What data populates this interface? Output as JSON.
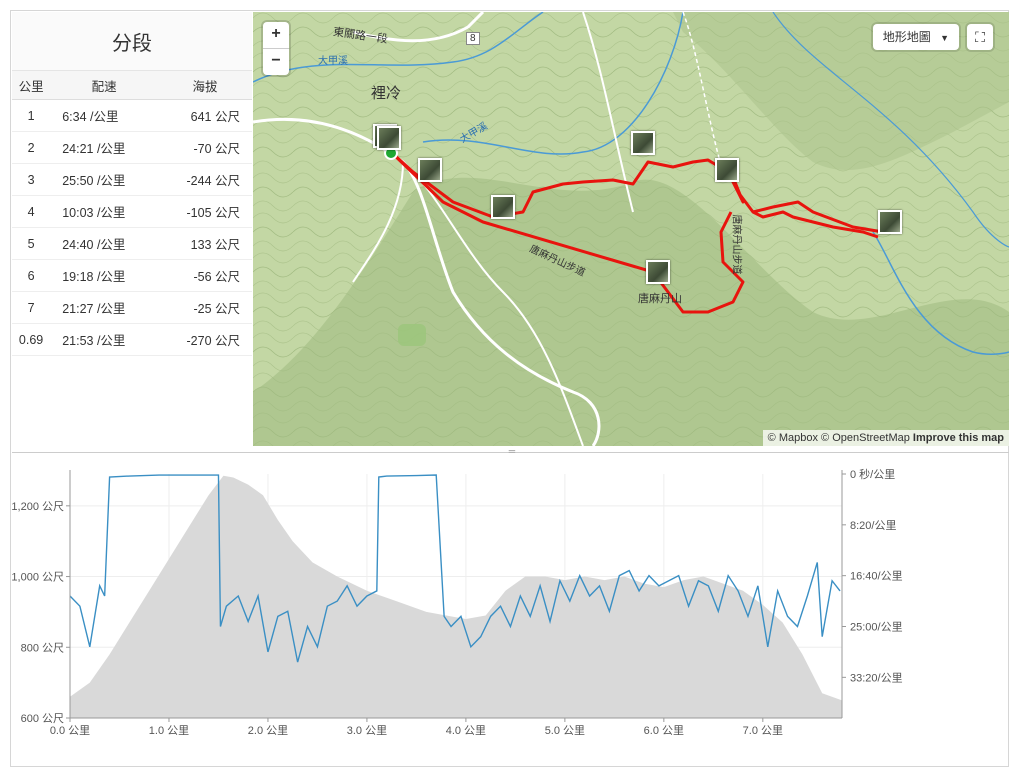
{
  "splits": {
    "title": "分段",
    "headers": [
      "公里",
      "配速",
      "海拔"
    ],
    "rows": [
      {
        "km": "1",
        "pace": "6:34 /公里",
        "elev": "641 公尺"
      },
      {
        "km": "2",
        "pace": "24:21 /公里",
        "elev": "-70 公尺"
      },
      {
        "km": "3",
        "pace": "25:50 /公里",
        "elev": "-244 公尺"
      },
      {
        "km": "4",
        "pace": "10:03 /公里",
        "elev": "-105 公尺"
      },
      {
        "km": "5",
        "pace": "24:40 /公里",
        "elev": "133 公尺"
      },
      {
        "km": "6",
        "pace": "19:18 /公里",
        "elev": "-56 公尺"
      },
      {
        "km": "7",
        "pace": "21:27 /公里",
        "elev": "-25 公尺"
      },
      {
        "km": "0.69",
        "pace": "21:53 /公里",
        "elev": "-270 公尺"
      }
    ]
  },
  "map": {
    "zoom_in": "+",
    "zoom_out": "−",
    "map_type": "地形地圖",
    "fullscreen_icon": "fullscreen-icon",
    "attribution_mapbox": "© Mapbox",
    "attribution_osm": "© OpenStreetMap",
    "attribution_improve": "Improve this map",
    "labels": {
      "town": "裡冷",
      "road": "東關路一段",
      "road_num": "8",
      "river": "大甲溪",
      "river2": "大甲溪",
      "peak": "唐麻丹山",
      "trail1": "唐麻丹山步道",
      "trail2": "唐麻丹山步道"
    },
    "route_color": "#e8140e",
    "terrain_color": "#bcd29c"
  },
  "chart_data": {
    "type": "line",
    "xlabel": "",
    "x_ticks": [
      "0.0 公里",
      "1.0 公里",
      "2.0 公里",
      "3.0 公里",
      "4.0 公里",
      "5.0 公里",
      "6.0 公里",
      "7.0 公里"
    ],
    "xlim": [
      0,
      7.8
    ],
    "left_axis": {
      "ticks": [
        "600 公尺",
        "800 公尺",
        "1,000 公尺",
        "1,200 公尺"
      ],
      "values": [
        600,
        800,
        1000,
        1200
      ],
      "lim": [
        600,
        1290
      ]
    },
    "right_axis": {
      "ticks": [
        "0 秒/公里",
        "8:20/公里",
        "16:40/公里",
        "25:00/公里",
        "33:20/公里"
      ],
      "values": [
        0,
        500,
        1000,
        1500,
        2000
      ],
      "lim": [
        0,
        2400
      ]
    },
    "series": [
      {
        "kind": "elevation_area",
        "color": "#d9d9d9",
        "x": [
          0,
          0.2,
          0.4,
          0.6,
          0.8,
          1.0,
          1.2,
          1.4,
          1.55,
          1.65,
          1.8,
          1.95,
          2.1,
          2.25,
          2.45,
          2.7,
          3.0,
          3.3,
          3.6,
          3.8,
          4.0,
          4.2,
          4.4,
          4.6,
          4.8,
          5.0,
          5.2,
          5.4,
          5.6,
          5.8,
          6.0,
          6.2,
          6.4,
          6.6,
          6.8,
          7.0,
          7.2,
          7.4,
          7.6,
          7.8
        ],
        "values": [
          660,
          700,
          780,
          870,
          960,
          1050,
          1140,
          1230,
          1285,
          1280,
          1260,
          1230,
          1160,
          1100,
          1040,
          1000,
          960,
          930,
          900,
          890,
          880,
          890,
          960,
          1000,
          1000,
          990,
          1000,
          990,
          1000,
          980,
          970,
          990,
          1000,
          980,
          960,
          920,
          870,
          780,
          670,
          650
        ]
      },
      {
        "kind": "pace_line",
        "color": "#3a8fc4",
        "x": [
          0,
          0.1,
          0.2,
          0.3,
          0.35,
          0.4,
          0.6,
          0.9,
          1.2,
          1.5,
          1.52,
          1.58,
          1.7,
          1.8,
          1.9,
          2.0,
          2.1,
          2.2,
          2.3,
          2.4,
          2.5,
          2.6,
          2.7,
          2.8,
          2.9,
          3.0,
          3.1,
          3.12,
          3.2,
          3.5,
          3.7,
          3.78,
          3.85,
          3.95,
          4.05,
          4.15,
          4.25,
          4.35,
          4.45,
          4.55,
          4.65,
          4.75,
          4.85,
          4.95,
          5.05,
          5.15,
          5.25,
          5.35,
          5.45,
          5.55,
          5.65,
          5.75,
          5.85,
          5.95,
          6.05,
          6.15,
          6.25,
          6.35,
          6.45,
          6.55,
          6.65,
          6.75,
          6.85,
          6.95,
          7.05,
          7.15,
          7.25,
          7.35,
          7.45,
          7.55,
          7.6,
          7.7,
          7.78
        ],
        "values": [
          1200,
          1300,
          1700,
          1100,
          1200,
          30,
          20,
          10,
          10,
          10,
          1500,
          1300,
          1200,
          1450,
          1200,
          1750,
          1400,
          1350,
          1850,
          1500,
          1700,
          1300,
          1250,
          1100,
          1300,
          1200,
          1150,
          30,
          20,
          15,
          10,
          1400,
          1500,
          1400,
          1700,
          1600,
          1400,
          1300,
          1500,
          1200,
          1400,
          1100,
          1450,
          1050,
          1250,
          1000,
          1200,
          1100,
          1350,
          1000,
          950,
          1150,
          1000,
          1100,
          1050,
          1000,
          1300,
          1050,
          1100,
          1350,
          1000,
          1150,
          1400,
          1100,
          1700,
          1150,
          1400,
          1500,
          1200,
          870,
          1600,
          1050,
          1150
        ]
      }
    ]
  }
}
